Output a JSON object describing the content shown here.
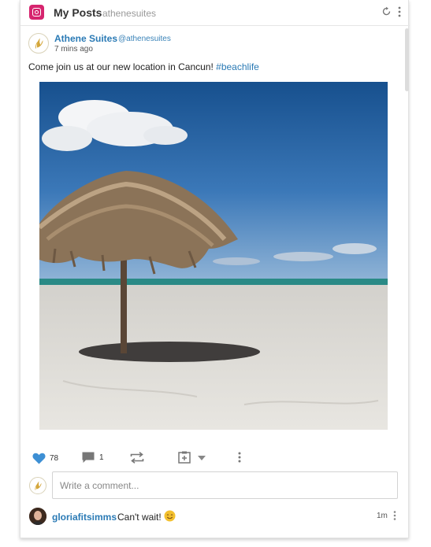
{
  "header": {
    "title": "My Posts",
    "account": "athenesuites",
    "icons": {
      "network": "instagram-icon",
      "refresh": "refresh-icon",
      "menu": "vertical-ellipsis-icon"
    }
  },
  "post": {
    "author_name": "Athene Suites",
    "author_handle": "@athenesuites",
    "time": "7 mins ago",
    "text": "Come join us at our new location in Cancun! ",
    "hashtag": "#beachlife",
    "image_icon": "beach-umbrella-photo"
  },
  "actions": {
    "like_count": "78",
    "comment_count": "1",
    "icons": [
      "heart-icon",
      "comment-icon",
      "repost-icon",
      "save-icon",
      "chevron-down-icon",
      "vertical-ellipsis-icon"
    ]
  },
  "comment_box": {
    "placeholder": "Write a comment..."
  },
  "comments": [
    {
      "author": "gloriafitsimms",
      "text": "Can't wait!",
      "emoji": "smiling-face-emoji",
      "time": "1m"
    }
  ],
  "colors": {
    "accent": "#2a7ab5",
    "like": "#3d8fd4",
    "brand": "#d6246e"
  }
}
